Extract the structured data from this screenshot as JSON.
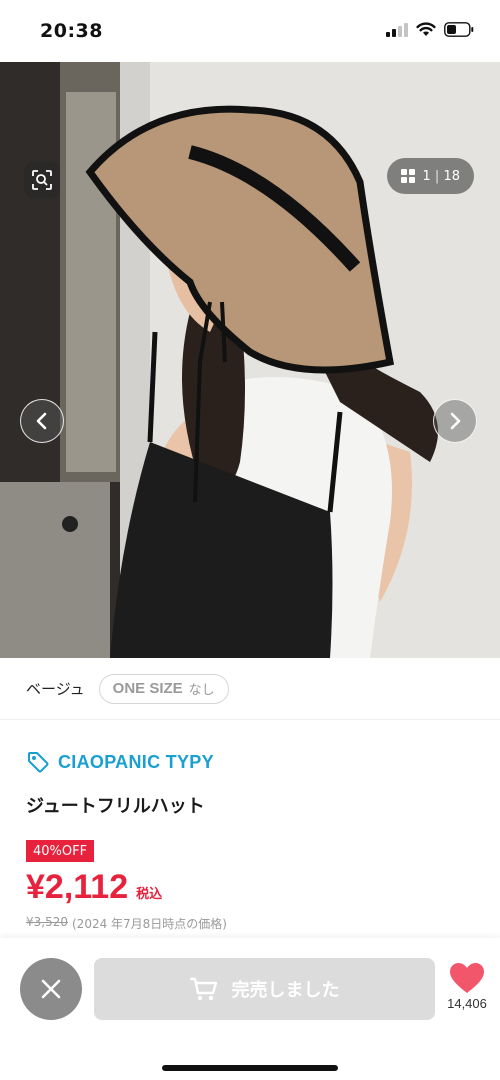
{
  "status_bar": {
    "time": "20:38"
  },
  "gallery": {
    "current": "1",
    "total": "18"
  },
  "variant": {
    "color": "ベージュ",
    "size": "ONE SIZE",
    "stock": "なし"
  },
  "product": {
    "brand": "CIAOPANIC TYPY",
    "title": "ジュートフリルハット",
    "discount": "40%OFF",
    "price": "¥2,112",
    "tax_label": "税込",
    "original_price": "¥3,520",
    "original_note": "(2024 年7月8日時点の価格)"
  },
  "bottom_bar": {
    "soldout_label": "完売しました",
    "favorite_count": "14,406"
  },
  "icons": [
    "signal-icon",
    "wifi-icon",
    "battery-icon",
    "lens-search-icon",
    "grid-icon",
    "chevron-left-icon",
    "chevron-right-icon",
    "tag-icon",
    "close-icon",
    "cart-icon",
    "heart-icon"
  ],
  "colors": {
    "accent_blue": "#1a9fd1",
    "sale_red": "#e8213c",
    "heart_pink": "#f2566a",
    "soldout_gray": "#dcdcdc"
  }
}
